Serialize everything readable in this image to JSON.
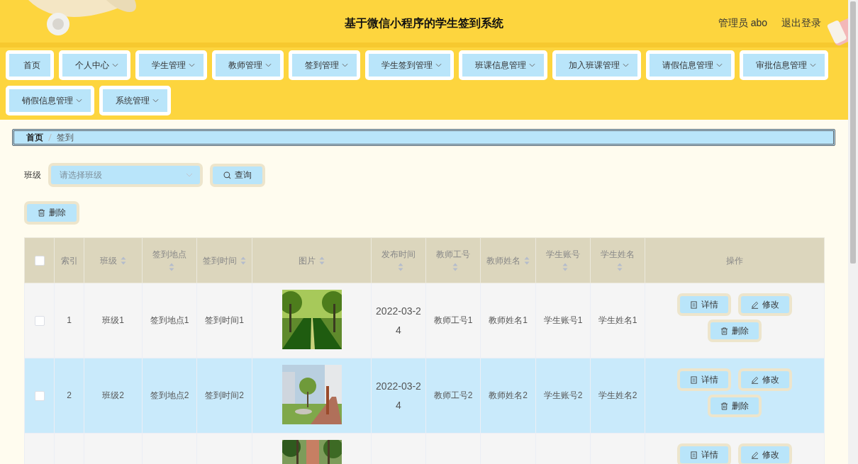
{
  "header": {
    "title": "基于微信小程序的学生签到系统",
    "user": "管理员 abo",
    "logout": "退出登录"
  },
  "nav": [
    {
      "label": "首页",
      "dropdown": false
    },
    {
      "label": "个人中心",
      "dropdown": true
    },
    {
      "label": "学生管理",
      "dropdown": true
    },
    {
      "label": "教师管理",
      "dropdown": true
    },
    {
      "label": "签到管理",
      "dropdown": true
    },
    {
      "label": "学生签到管理",
      "dropdown": true
    },
    {
      "label": "班课信息管理",
      "dropdown": true
    },
    {
      "label": "加入班课管理",
      "dropdown": true
    },
    {
      "label": "请假信息管理",
      "dropdown": true
    },
    {
      "label": "审批信息管理",
      "dropdown": true
    },
    {
      "label": "销假信息管理",
      "dropdown": true
    },
    {
      "label": "系统管理",
      "dropdown": true
    }
  ],
  "breadcrumb": [
    {
      "label": "首页",
      "current": false
    },
    {
      "label": "签到",
      "current": true
    }
  ],
  "search": {
    "label": "班级",
    "placeholder": "请选择班级",
    "button": "查询"
  },
  "delete_button": "删除",
  "table": {
    "select_all": {
      "checked": false
    },
    "columns": [
      {
        "kind": "text",
        "label": "索引",
        "sortable": false
      },
      {
        "kind": "text",
        "label": "班级",
        "sortable": true
      },
      {
        "kind": "text",
        "label": "签到地点",
        "sortable": true
      },
      {
        "kind": "text",
        "label": "签到时间",
        "sortable": true
      },
      {
        "kind": "picture",
        "label": "图片",
        "sortable": true
      },
      {
        "kind": "text",
        "label": "发布时间",
        "sortable": true
      },
      {
        "kind": "text",
        "label": "教师工号",
        "sortable": true
      },
      {
        "kind": "text",
        "label": "教师姓名",
        "sortable": true
      },
      {
        "kind": "text",
        "label": "学生账号",
        "sortable": true
      },
      {
        "kind": "text",
        "label": "学生姓名",
        "sortable": true
      },
      {
        "kind": "actions",
        "label": "操作",
        "sortable": false
      }
    ],
    "rows": [
      {
        "selected": false,
        "checked": false,
        "cells": [
          "1",
          "班级1",
          "签到地点1",
          "签到时间1",
          {
            "kind": "picture"
          },
          "2022-03-24",
          "教师工号1",
          "教师姓名1",
          "学生账号1",
          "学生姓名1"
        ],
        "actions": [
          {
            "kind": "detail",
            "label": "详情"
          },
          {
            "kind": "edit",
            "label": "修改"
          },
          {
            "kind": "delete",
            "label": "删除"
          }
        ]
      },
      {
        "selected": true,
        "checked": false,
        "cells": [
          "2",
          "班级2",
          "签到地点2",
          "签到时间2",
          {
            "kind": "picture"
          },
          "2022-03-24",
          "教师工号2",
          "教师姓名2",
          "学生账号2",
          "学生姓名2"
        ],
        "actions": [
          {
            "kind": "detail",
            "label": "详情"
          },
          {
            "kind": "edit",
            "label": "修改"
          },
          {
            "kind": "delete",
            "label": "删除"
          }
        ]
      },
      {
        "selected": false,
        "cells": [],
        "actions": [
          {
            "kind": "detail",
            "label": "详情"
          },
          {
            "kind": "edit",
            "label": "修改"
          }
        ]
      }
    ]
  }
}
